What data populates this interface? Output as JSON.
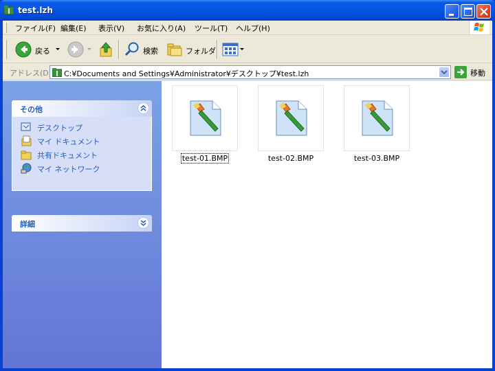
{
  "window": {
    "title": "test.lzh"
  },
  "menubar": {
    "items": [
      {
        "label": "ファイル(F)"
      },
      {
        "label": "編集(E)"
      },
      {
        "label": "表示(V)"
      },
      {
        "label": "お気に入り(A)"
      },
      {
        "label": "ツール(T)"
      },
      {
        "label": "ヘルプ(H)"
      }
    ]
  },
  "toolbar": {
    "back_label": "戻る",
    "search_label": "検索",
    "folders_label": "フォルダ"
  },
  "address": {
    "label": "アドレス(D)",
    "value": "C:¥Documents and Settings¥Administrator¥デスクトップ¥test.lzh",
    "go_label": "移動"
  },
  "taskpane": {
    "other_places": {
      "title": "その他",
      "links": [
        {
          "label": "デスクトップ",
          "icon": "desktop-icon"
        },
        {
          "label": "マイ ドキュメント",
          "icon": "my-documents-icon"
        },
        {
          "label": "共有ドキュメント",
          "icon": "shared-documents-icon"
        },
        {
          "label": "マイ ネットワーク",
          "icon": "my-network-icon"
        }
      ]
    },
    "details": {
      "title": "詳細"
    }
  },
  "files": [
    {
      "name": "test-01.BMP",
      "icon": "bitmap-paint-icon",
      "selected": true
    },
    {
      "name": "test-02.BMP",
      "icon": "bitmap-paint-icon",
      "selected": false
    },
    {
      "name": "test-03.BMP",
      "icon": "bitmap-paint-icon",
      "selected": false
    }
  ],
  "colors": {
    "titlebar": "#0556e4",
    "taskpane_link": "#215dc6",
    "taskpane_bg": "#6375d6"
  }
}
